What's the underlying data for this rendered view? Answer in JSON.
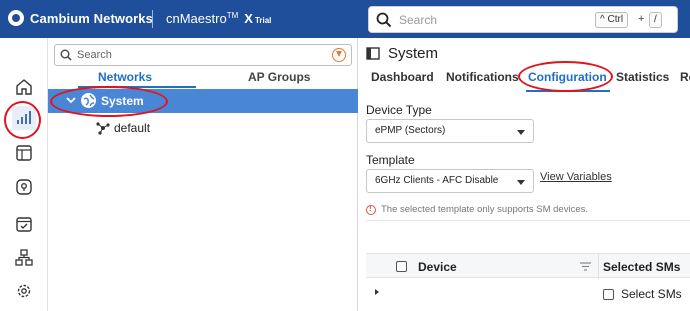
{
  "colors": {
    "topbar": "#1f4f9a",
    "accent": "#1f6fc6",
    "selected_row": "#4a86d6",
    "annotation": "#e0141e",
    "warning": "#d9534f"
  },
  "header": {
    "brand": "Cambium Networks",
    "product": "cnMaestro",
    "tm": "TM",
    "product_x": "X",
    "trial": "Trial",
    "search_placeholder": "Search",
    "shortcut_key1": "Ctrl",
    "shortcut_plus": "+",
    "shortcut_key2": "/"
  },
  "rail": {
    "items": [
      {
        "name": "home-icon"
      },
      {
        "name": "monitor-icon",
        "selected": true
      },
      {
        "name": "dashboard-icon"
      },
      {
        "name": "map-icon"
      },
      {
        "name": "tasks-icon"
      },
      {
        "name": "network-icon"
      },
      {
        "name": "settings-icon"
      }
    ]
  },
  "tree": {
    "search_placeholder": "Search",
    "tabs": [
      "Networks",
      "AP Groups"
    ],
    "active_tab": "Networks",
    "nodes": [
      {
        "label": "System",
        "selected": true,
        "expanded": true
      },
      {
        "label": "default",
        "selected": false
      }
    ]
  },
  "main": {
    "title": "System",
    "tabs": [
      "Dashboard",
      "Notifications",
      "Configuration",
      "Statistics",
      "Re"
    ],
    "active_tab": "Configuration",
    "device_type": {
      "label": "Device Type",
      "value": "ePMP (Sectors)"
    },
    "template": {
      "label": "Template",
      "value": "6GHz Clients - AFC Disable",
      "link": "View Variables"
    },
    "note": "The selected template only supports SM devices.",
    "table": {
      "columns": [
        "Device",
        "Selected SMs"
      ],
      "row_checkbox_label": "Select SMs"
    }
  }
}
